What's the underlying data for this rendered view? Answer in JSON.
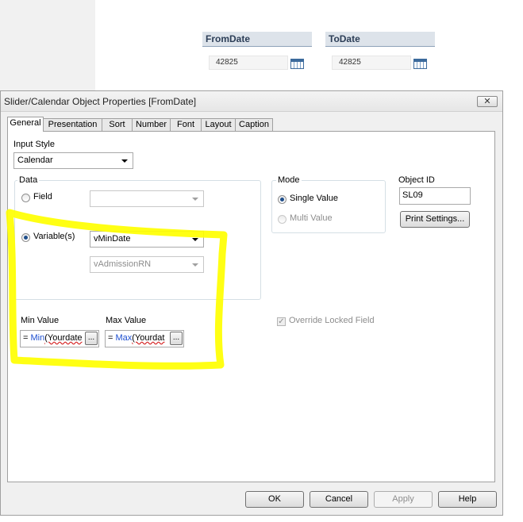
{
  "background": {
    "from_date": {
      "header": "FromDate",
      "value": "42825"
    },
    "to_date": {
      "header": "ToDate",
      "value": "42825"
    }
  },
  "dialog": {
    "title": "Slider/Calendar Object Properties [FromDate]",
    "close_glyph": "✕",
    "tabs": [
      "General",
      "Presentation",
      "Sort",
      "Number",
      "Font",
      "Layout",
      "Caption"
    ],
    "active_tab": "General",
    "input_style": {
      "label": "Input Style",
      "value": "Calendar"
    },
    "data_group": {
      "title": "Data",
      "field_label": "Field",
      "field_value": "",
      "variables_label": "Variable(s)",
      "variable_1": "vMinDate",
      "variable_2": "vAdmissionRN",
      "selected": "Variable(s)"
    },
    "mode_group": {
      "title": "Mode",
      "single_value": "Single Value",
      "multi_value": "Multi Value",
      "selected": "Single Value"
    },
    "object_id": {
      "label": "Object ID",
      "value": "SL09"
    },
    "print_settings": "Print Settings...",
    "min_value": {
      "label": "Min Value",
      "prefix": "= ",
      "func": "Min",
      "arg": "(Yourdate"
    },
    "max_value": {
      "label": "Max Value",
      "prefix": "= ",
      "func": "Max",
      "arg": "(Yourdat"
    },
    "ellipsis": "...",
    "override_locked": {
      "label": "Override Locked Field",
      "checked": true
    },
    "buttons": {
      "ok": "OK",
      "cancel": "Cancel",
      "apply": "Apply",
      "help": "Help"
    }
  },
  "colors": {
    "highlight": "#ffff00",
    "function_blue": "#1d4fd0",
    "date_header": "#dde3ea"
  }
}
